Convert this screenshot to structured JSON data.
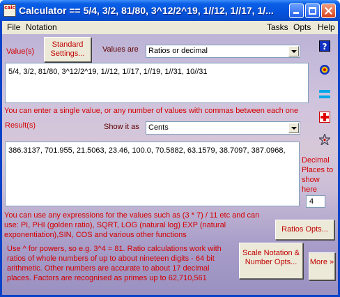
{
  "window": {
    "title": "Calculator == 5/4, 3/2, 81/80, 3^12/2^19, 1//12, 1//17, 1/...",
    "app_icon_text": "calc"
  },
  "menu": {
    "file": "File",
    "notation": "Notation",
    "tasks": "Tasks",
    "opts": "Opts",
    "help": "Help"
  },
  "input": {
    "values_label": "Value(s)",
    "standard_settings_button": "Standard Settings...",
    "values_are_label": "Values are",
    "values_are_selected": "Ratios or decimal",
    "values_text": "5/4,  3/2,  81/80,  3^12/2^19,  1//12,  1//17,  1//19,  1//31,  10//31",
    "hint": "You can enter a single value, or any number of values with commas between each one"
  },
  "result": {
    "result_label": "Result(s)",
    "show_it_as_label": "Show it as",
    "show_it_as_selected": "Cents",
    "result_text": "386.3137, 701.955, 21.5063, 23.46, 100.0, 70.5882, 63.1579, 38.7097, 387.0968,",
    "decimal_places_label": "Decimal Places to show here",
    "decimal_places_value": "4"
  },
  "help": {
    "expressions_text": "You can use any expressions for the values such as (3 * 7) / 11 etc and can use: PI, PHI (golden ratio), SQRT, LOG (natural log) EXP (natural exponentiation),SIN, COS and various other functions",
    "powers_text": "Use ^ for powers, so e.g. 3^4 = 81. Ratio calculations work with ratios of whole numbers of up to about nineteen digits - 64 bit arithmetic. Other numbers are accurate to about 17 decimal places. Factors are recognised as primes up to 62,710,561"
  },
  "buttons": {
    "ratios_opts": "Ratios Opts...",
    "scale_notation": "Scale Notation & Number Opts...",
    "more": "More »"
  },
  "side_icons": [
    "help-icon",
    "target-icon",
    "equals-icon",
    "plus-icon",
    "star-icon"
  ],
  "colors": {
    "titlebar": "#0553dc",
    "label_red": "#d40000",
    "client_bg": "#cfc3dd"
  }
}
